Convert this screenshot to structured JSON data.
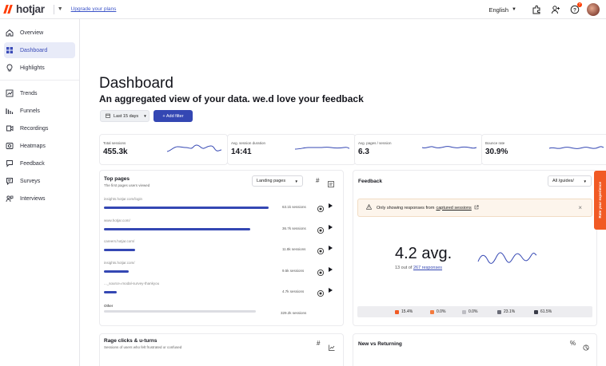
{
  "topbar": {
    "logo_text": "hotjar",
    "upgrade_link": "Upgrade your plans",
    "language": "English",
    "notification_count": "7"
  },
  "sidebar": {
    "items": [
      {
        "label": "Overview",
        "icon": "home-icon"
      },
      {
        "label": "Dashboard",
        "icon": "dashboard-icon",
        "active": true
      },
      {
        "label": "Highlights",
        "icon": "lightbulb-icon"
      },
      {
        "label": "Trends",
        "icon": "trends-icon"
      },
      {
        "label": "Funnels",
        "icon": "funnel-icon"
      },
      {
        "label": "Recordings",
        "icon": "recordings-icon"
      },
      {
        "label": "Heatmaps",
        "icon": "heatmap-icon"
      },
      {
        "label": "Feedback",
        "icon": "feedback-icon"
      },
      {
        "label": "Surveys",
        "icon": "survey-icon"
      },
      {
        "label": "Interviews",
        "icon": "interviews-icon"
      }
    ]
  },
  "header": {
    "title": "Dashboard",
    "subtitle": "An aggregated view of your data. we.d love your feedback",
    "date_range": "Last 15 days",
    "add_filter": "+ Add filter"
  },
  "metrics": [
    {
      "label": "Total sessions",
      "value": "455.3k"
    },
    {
      "label": "Avg. session duration",
      "value": "14:41"
    },
    {
      "label": "Avg. pages / session",
      "value": "6.3"
    },
    {
      "label": "Bounce rate",
      "value": "30.9%"
    }
  ],
  "top_pages": {
    "title": "Top pages",
    "subtitle": "The first pages users viewed",
    "dropdown": "Landing pages",
    "rows": [
      {
        "url": "insights.hotjar.com/login",
        "count": "63.1k sessions",
        "fraction": 1.0
      },
      {
        "url": "www.hotjar.com/",
        "count": "36.7k sessions",
        "fraction": 0.89
      },
      {
        "url": "careers.hotjar.com/",
        "count": "11.8k sessions",
        "fraction": 0.19
      },
      {
        "url": "insights.hotjar.com/",
        "count": "9.5k sessions",
        "fraction": 0.15
      },
      {
        "url": "..._source=modal-survey-thankyou",
        "count": "4.7k sessions",
        "fraction": 0.08
      }
    ],
    "other_label": "Other",
    "other_count": "329.2k sessions"
  },
  "feedback": {
    "title": "Feedback",
    "dropdown": "All /guides/",
    "notice_text": "Only showing responses from",
    "notice_link": "captured sessions",
    "avg_value": "4.2 avg.",
    "responses_prefix": "13 out of",
    "responses_link": "267 responses",
    "scores": [
      {
        "value": "15.4%",
        "color": "#f15a24"
      },
      {
        "value": "0.0%",
        "color": "#f47b3e"
      },
      {
        "value": "0.0%",
        "color": "#bdbdc3"
      },
      {
        "value": "23.1%",
        "color": "#6b6d78"
      },
      {
        "value": "61.5%",
        "color": "#3a3c48"
      }
    ]
  },
  "rage_clicks": {
    "title": "Rage clicks & u-turns",
    "subtitle": "Sessions of users who felt frustrated or confused"
  },
  "new_vs_returning": {
    "title": "New vs Returning"
  },
  "feedback_tab": {
    "label": "Rate your experience"
  }
}
